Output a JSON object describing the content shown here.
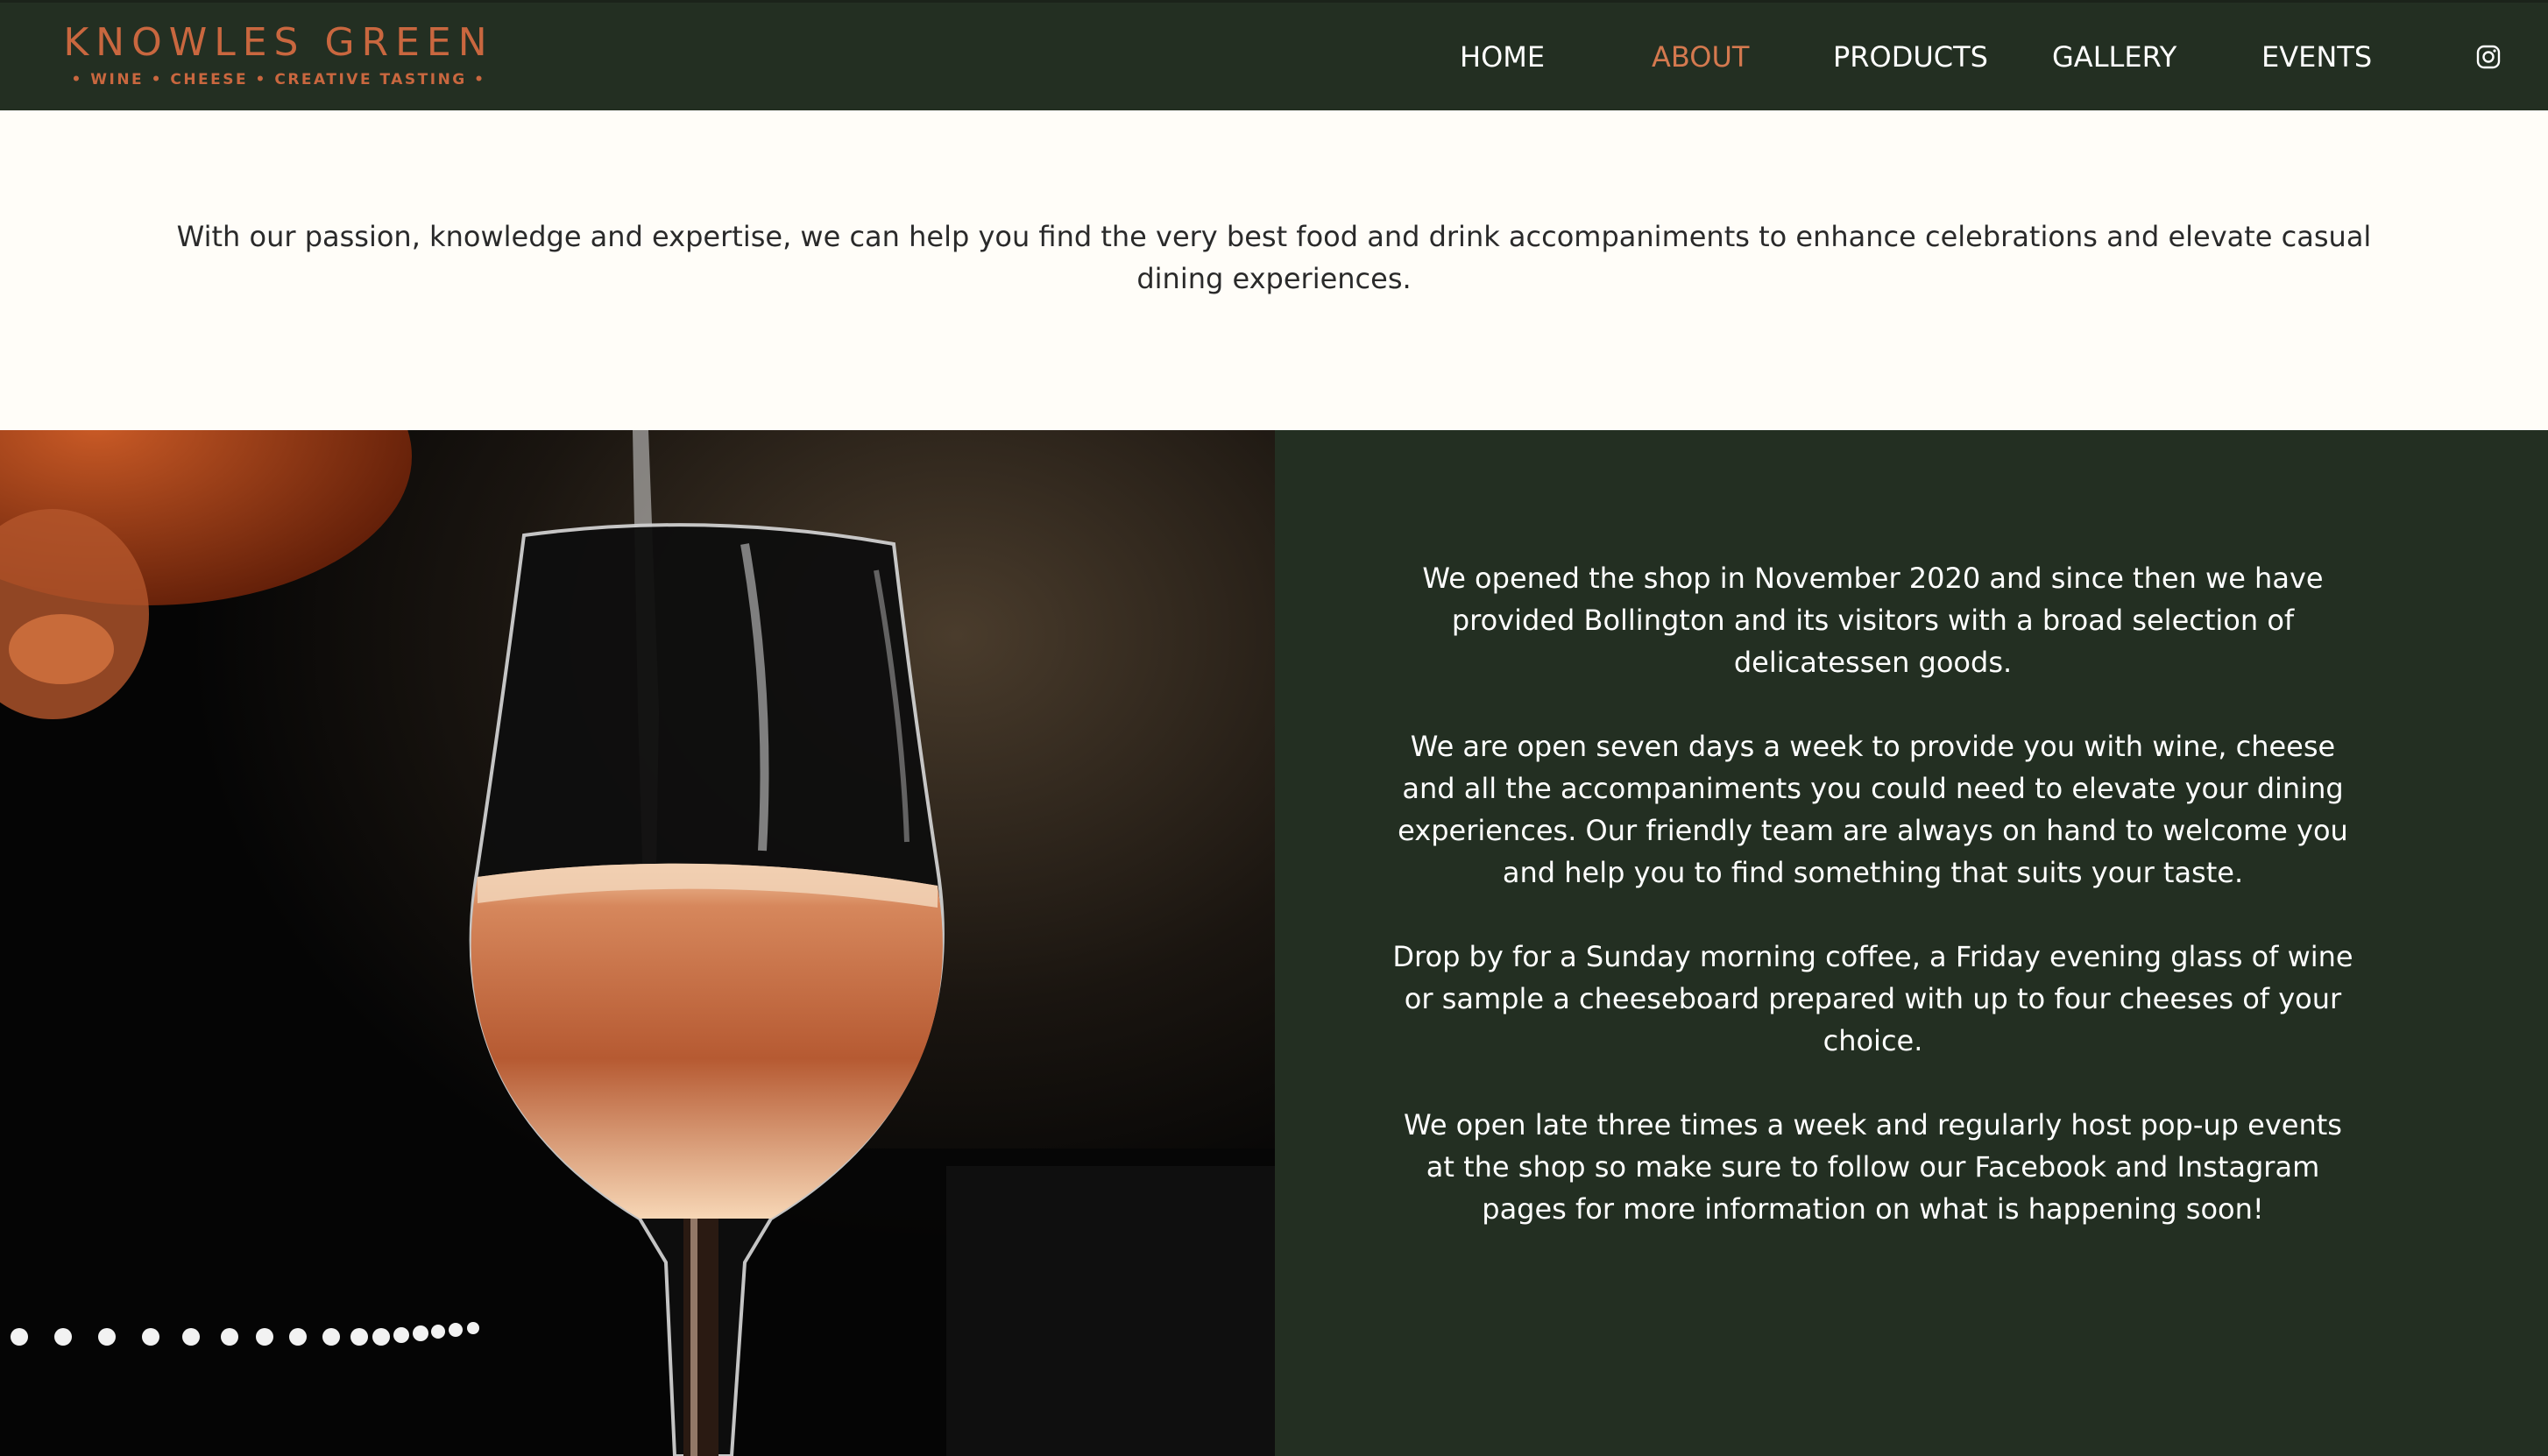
{
  "brand": {
    "title": "KNOWLES GREEN",
    "tagline": "• WINE • CHEESE • CREATIVE TASTING •"
  },
  "nav": {
    "items": [
      {
        "label": "HOME",
        "active": false
      },
      {
        "label": "ABOUT",
        "active": true
      },
      {
        "label": "PRODUCTS",
        "active": false
      },
      {
        "label": "GALLERY",
        "active": false
      },
      {
        "label": "EVENTS",
        "active": false
      }
    ],
    "social_icon": "instagram-icon"
  },
  "intro": {
    "text": "With our passion, knowledge and expertise, we can help you find the very best food and drink accompaniments to enhance celebrations and elevate casual dining experiences."
  },
  "photo": {
    "subject": "rose-wine-glass"
  },
  "about": {
    "paragraphs": [
      "We opened the shop in November 2020 and since then we have provided Bollington and its visitors with a broad selection of delicatessen goods.",
      "We are open seven days a week to provide you with wine, cheese and all the accompaniments you could need to elevate your dining experiences. Our friendly team are always on hand to welcome you and help you to find something that suits your taste.",
      "Drop by for a Sunday morning coffee, a Friday evening glass of wine or sample a cheeseboard prepared with up to four cheeses of your choice.",
      "We open late three times a week and regularly host pop-up events at the shop so make sure to follow our Facebook and Instagram pages for more information on what is happening soon!"
    ]
  },
  "colors": {
    "header_bg": "#232f22",
    "brand_accent": "#c9673f",
    "active_nav": "#d4794f",
    "page_bg": "#fffdf8",
    "panel_bg": "#232f22"
  }
}
